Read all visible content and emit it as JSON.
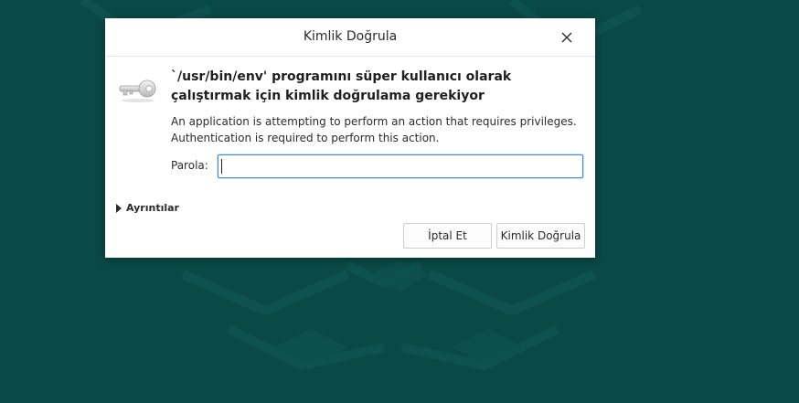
{
  "dialog": {
    "title": "Kimlik Doğrula",
    "close_icon": "close-icon",
    "key_icon": "key-icon",
    "heading": "`/usr/bin/env' programını süper kullanıcı olarak çalıştırmak için kimlik doğrulama gerekiyor",
    "description_line1": "An application is attempting to perform an action that requires privileges.",
    "description_line2": "Authentication is required to perform this action.",
    "password_label": "Parola:",
    "password_value": "",
    "details_label": "Ayrıntılar",
    "cancel_label": "İptal Et",
    "authenticate_label": "Kimlik Doğrula"
  },
  "colors": {
    "desktop_background": "#0a4a46",
    "dialog_background": "#ffffff",
    "input_focus_border": "#3f8fd0"
  }
}
